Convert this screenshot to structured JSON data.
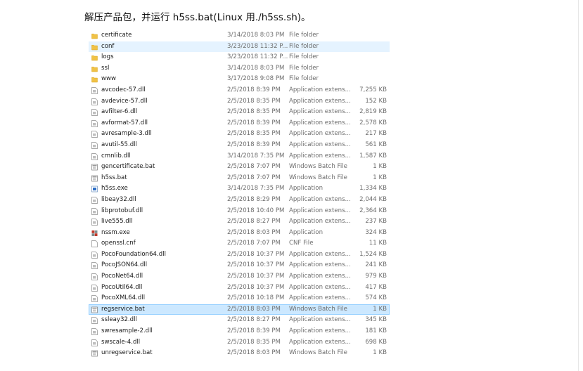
{
  "heading": "解压产品包，并运行 h5ss.bat(Linux 用./h5ss.sh)。",
  "colors": {
    "folder": "#f0c246",
    "hover_row": "#e5f3ff",
    "selected_row": "#cce8ff"
  },
  "files": [
    {
      "name": "certificate",
      "date": "3/14/2018 8:03 PM",
      "type": "File folder",
      "size": "",
      "icon": "folder-icon"
    },
    {
      "name": "conf",
      "date": "3/23/2018 11:32 P...",
      "type": "File folder",
      "size": "",
      "icon": "folder-icon",
      "state": "hover"
    },
    {
      "name": "logs",
      "date": "3/23/2018 11:32 P...",
      "type": "File folder",
      "size": "",
      "icon": "folder-icon"
    },
    {
      "name": "ssl",
      "date": "3/14/2018 8:03 PM",
      "type": "File folder",
      "size": "",
      "icon": "folder-icon"
    },
    {
      "name": "www",
      "date": "3/17/2018 9:08 PM",
      "type": "File folder",
      "size": "",
      "icon": "folder-icon"
    },
    {
      "name": "avcodec-57.dll",
      "date": "2/5/2018 8:39 PM",
      "type": "Application extens...",
      "size": "7,255 KB",
      "icon": "dll-file-icon"
    },
    {
      "name": "avdevice-57.dll",
      "date": "2/5/2018 8:35 PM",
      "type": "Application extens...",
      "size": "152 KB",
      "icon": "dll-file-icon"
    },
    {
      "name": "avfilter-6.dll",
      "date": "2/5/2018 8:35 PM",
      "type": "Application extens...",
      "size": "2,819 KB",
      "icon": "dll-file-icon"
    },
    {
      "name": "avformat-57.dll",
      "date": "2/5/2018 8:39 PM",
      "type": "Application extens...",
      "size": "2,578 KB",
      "icon": "dll-file-icon"
    },
    {
      "name": "avresample-3.dll",
      "date": "2/5/2018 8:35 PM",
      "type": "Application extens...",
      "size": "217 KB",
      "icon": "dll-file-icon"
    },
    {
      "name": "avutil-55.dll",
      "date": "2/5/2018 8:39 PM",
      "type": "Application extens...",
      "size": "561 KB",
      "icon": "dll-file-icon"
    },
    {
      "name": "cmnlib.dll",
      "date": "3/14/2018 7:35 PM",
      "type": "Application extens...",
      "size": "1,587 KB",
      "icon": "dll-file-icon"
    },
    {
      "name": "gencertificate.bat",
      "date": "2/5/2018 7:07 PM",
      "type": "Windows Batch File",
      "size": "1 KB",
      "icon": "batch-file-icon"
    },
    {
      "name": "h5ss.bat",
      "date": "2/5/2018 7:07 PM",
      "type": "Windows Batch File",
      "size": "1 KB",
      "icon": "batch-file-icon"
    },
    {
      "name": "h5ss.exe",
      "date": "3/14/2018 7:35 PM",
      "type": "Application",
      "size": "1,334 KB",
      "icon": "exe-file-icon"
    },
    {
      "name": "libeay32.dll",
      "date": "2/5/2018 8:29 PM",
      "type": "Application extens...",
      "size": "2,044 KB",
      "icon": "dll-file-icon"
    },
    {
      "name": "libprotobuf.dll",
      "date": "2/5/2018 10:40 PM",
      "type": "Application extens...",
      "size": "2,364 KB",
      "icon": "dll-file-icon"
    },
    {
      "name": "live555.dll",
      "date": "2/5/2018 8:27 PM",
      "type": "Application extens...",
      "size": "237 KB",
      "icon": "dll-file-icon"
    },
    {
      "name": "nssm.exe",
      "date": "2/5/2018 8:03 PM",
      "type": "Application",
      "size": "324 KB",
      "icon": "nssm-exe-icon"
    },
    {
      "name": "openssl.cnf",
      "date": "2/5/2018 7:07 PM",
      "type": "CNF File",
      "size": "11 KB",
      "icon": "blank-file-icon"
    },
    {
      "name": "PocoFoundation64.dll",
      "date": "2/5/2018 10:37 PM",
      "type": "Application extens...",
      "size": "1,524 KB",
      "icon": "dll-file-icon"
    },
    {
      "name": "PocoJSON64.dll",
      "date": "2/5/2018 10:37 PM",
      "type": "Application extens...",
      "size": "241 KB",
      "icon": "dll-file-icon"
    },
    {
      "name": "PocoNet64.dll",
      "date": "2/5/2018 10:37 PM",
      "type": "Application extens...",
      "size": "979 KB",
      "icon": "dll-file-icon"
    },
    {
      "name": "PocoUtil64.dll",
      "date": "2/5/2018 10:37 PM",
      "type": "Application extens...",
      "size": "417 KB",
      "icon": "dll-file-icon"
    },
    {
      "name": "PocoXML64.dll",
      "date": "2/5/2018 10:18 PM",
      "type": "Application extens...",
      "size": "574 KB",
      "icon": "dll-file-icon"
    },
    {
      "name": "regservice.bat",
      "date": "2/5/2018 8:03 PM",
      "type": "Windows Batch File",
      "size": "1 KB",
      "icon": "batch-file-icon",
      "state": "selected"
    },
    {
      "name": "ssleay32.dll",
      "date": "2/5/2018 8:27 PM",
      "type": "Application extens...",
      "size": "345 KB",
      "icon": "dll-file-icon"
    },
    {
      "name": "swresample-2.dll",
      "date": "2/5/2018 8:39 PM",
      "type": "Application extens...",
      "size": "181 KB",
      "icon": "dll-file-icon"
    },
    {
      "name": "swscale-4.dll",
      "date": "2/5/2018 8:35 PM",
      "type": "Application extens...",
      "size": "698 KB",
      "icon": "dll-file-icon"
    },
    {
      "name": "unregservice.bat",
      "date": "2/5/2018 8:03 PM",
      "type": "Windows Batch File",
      "size": "1 KB",
      "icon": "batch-file-icon"
    }
  ]
}
